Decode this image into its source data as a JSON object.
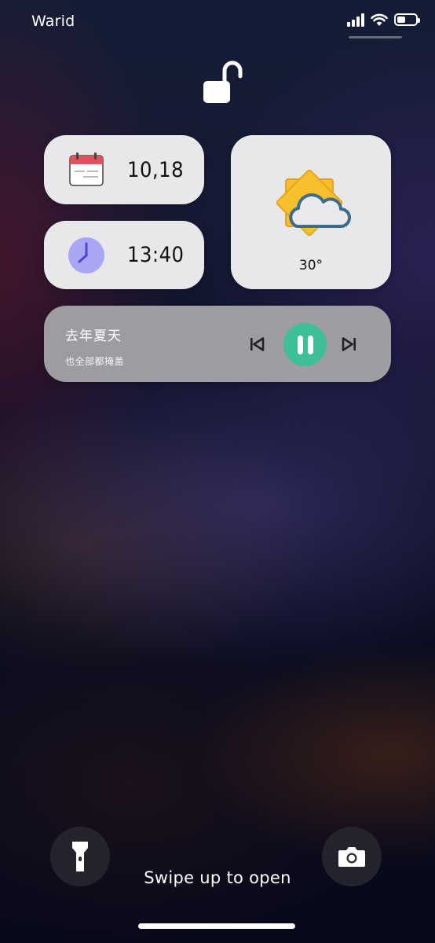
{
  "status_bar": {
    "carrier": "Warid",
    "icons": [
      "cellular-signal-icon",
      "wifi-icon",
      "battery-icon"
    ],
    "battery_level": 0.45
  },
  "lock": {
    "icon": "unlocked-padlock-icon"
  },
  "widgets": {
    "date": {
      "icon": "calendar-icon",
      "value": "10,18"
    },
    "clock": {
      "icon": "clock-icon",
      "value": "13:40"
    },
    "weather": {
      "icon": "sun-behind-cloud-icon",
      "temperature": "30°"
    }
  },
  "music": {
    "title": "去年夏天",
    "artist": "也全部都掩盖",
    "state": "playing",
    "controls": [
      "skip-previous-icon",
      "pause-icon",
      "skip-next-icon"
    ]
  },
  "bottom": {
    "flashlight_icon": "flashlight-icon",
    "camera_icon": "camera-icon",
    "swipe_hint": "Swipe up to open"
  },
  "colors": {
    "widget_bg": "#e8e8ea",
    "play_button": "#3fbf97",
    "clock_face": "#a9a6f5",
    "calendar_red": "#e2505c",
    "sun": "#f7bf2e",
    "cloud_outline": "#3d6c8f"
  }
}
